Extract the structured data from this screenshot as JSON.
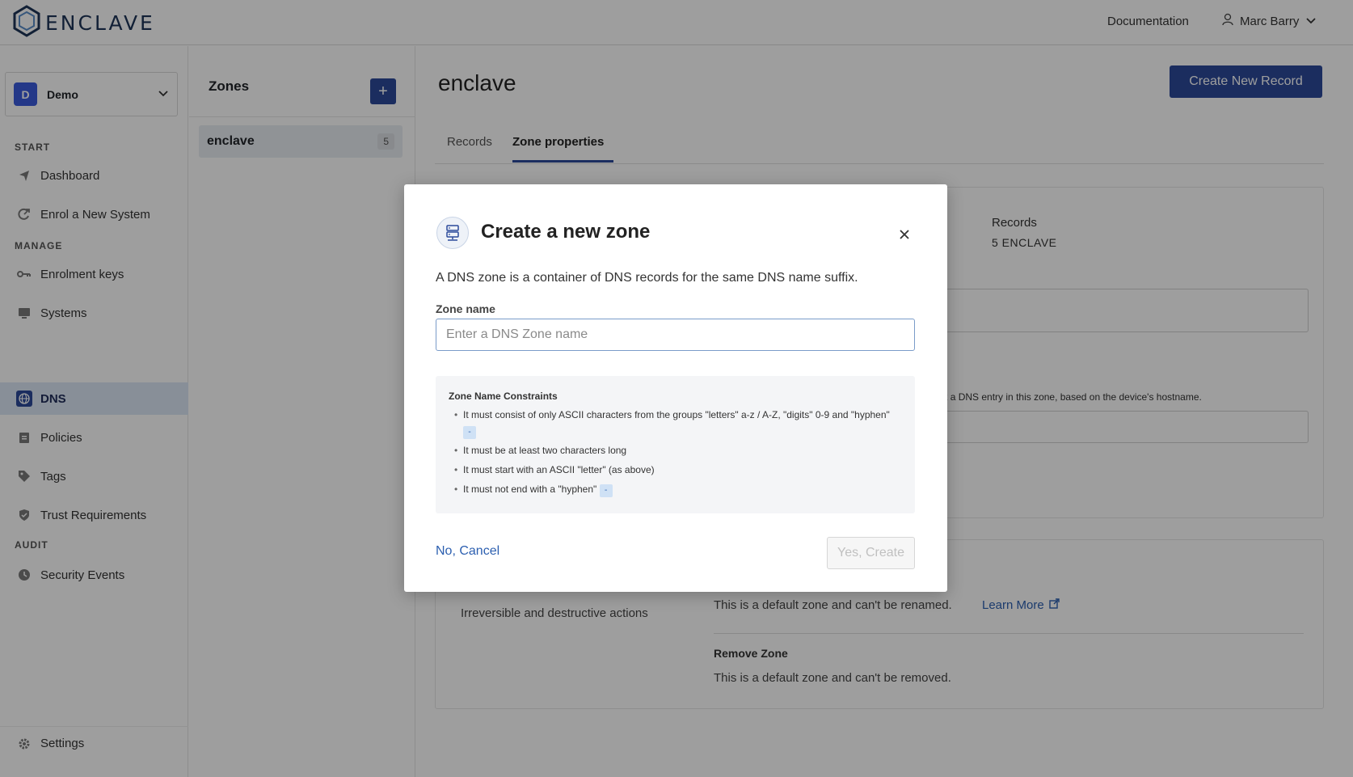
{
  "app": {
    "logo_text": "ENCLAVE"
  },
  "topbar": {
    "documentation": "Documentation",
    "user_name": "Marc Barry"
  },
  "org": {
    "initial": "D",
    "name": "Demo"
  },
  "sidebar": {
    "sections": {
      "start": "START",
      "manage": "MANAGE",
      "audit": "AUDIT"
    },
    "items": [
      {
        "label": "Dashboard",
        "icon": "send-icon"
      },
      {
        "label": "Enrol a New System",
        "icon": "enrol-icon"
      },
      {
        "label": "Enrolment keys",
        "icon": "key-icon"
      },
      {
        "label": "Systems",
        "icon": "monitor-icon"
      },
      {
        "label": "DNS",
        "icon": "globe-icon"
      },
      {
        "label": "Policies",
        "icon": "clipboard-icon"
      },
      {
        "label": "Tags",
        "icon": "tag-icon"
      },
      {
        "label": "Trust Requirements",
        "icon": "shield-icon"
      },
      {
        "label": "Security Events",
        "icon": "clock-icon"
      }
    ],
    "settings": "Settings"
  },
  "zones_panel": {
    "title": "Zones",
    "add_label": "+",
    "rows": [
      {
        "name": "enclave",
        "count": "5"
      }
    ]
  },
  "main": {
    "title": "enclave",
    "create_button": "Create New Record",
    "tabs": [
      {
        "label": "Records"
      },
      {
        "label": "Zone properties",
        "active": true
      }
    ],
    "records_label": "Records",
    "records_value": "5 ENCLAVE",
    "hostname_hint": "omatically get a DNS entry in this zone, based on the device's hostname.",
    "danger_desc": "Irreversible and destructive actions",
    "rename_text": "This is a default zone and can't be renamed.",
    "learn_more": "Learn More",
    "remove_title": "Remove Zone",
    "remove_text": "This is a default zone and can't be removed."
  },
  "modal": {
    "title": "Create a new zone",
    "description": "A DNS zone is a container of DNS records for the same DNS name suffix.",
    "field_label": "Zone name",
    "input_placeholder": "Enter a DNS Zone name",
    "input_value": "",
    "constraints_title": "Zone Name Constraints",
    "constraints": [
      {
        "text": "It must consist of only ASCII characters from the groups \"letters\" a-z / A-Z, \"digits\" 0-9 and \"hyphen\"",
        "code": "-"
      },
      {
        "text": "It must be at least two characters long",
        "code": ""
      },
      {
        "text": "It must start with an ASCII \"letter\" (as above)",
        "code": ""
      },
      {
        "text": "It must not end with a \"hyphen\"",
        "code": "-"
      }
    ],
    "cancel": "No, Cancel",
    "confirm": "Yes, Create"
  },
  "colors": {
    "accent": "#2c4a9a",
    "link": "#2c5fb0",
    "active_nav_bg": "#dbe7f5"
  }
}
